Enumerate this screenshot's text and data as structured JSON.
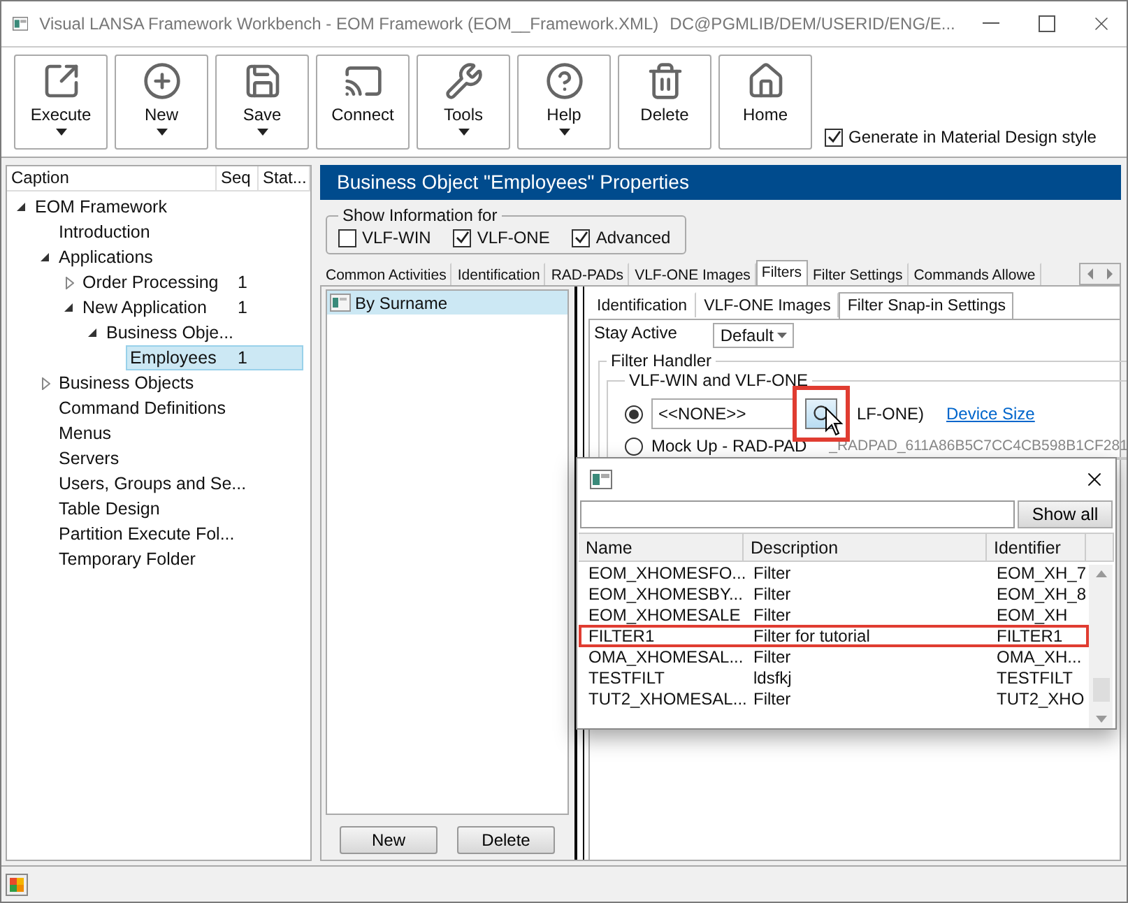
{
  "window": {
    "title": "Visual LANSA Framework Workbench - EOM Framework (EOM__Framework.XML)",
    "location": "DC@PGMLIB/DEM/USERID/ENG/E..."
  },
  "toolbar": [
    {
      "label": "Execute",
      "dropdown": true
    },
    {
      "label": "New",
      "dropdown": true
    },
    {
      "label": "Save",
      "dropdown": true
    },
    {
      "label": "Connect",
      "dropdown": false
    },
    {
      "label": "Tools",
      "dropdown": true
    },
    {
      "label": "Help",
      "dropdown": true
    },
    {
      "label": "Delete",
      "dropdown": false
    },
    {
      "label": "Home",
      "dropdown": false
    }
  ],
  "material_option": {
    "label": "Generate in Material Design style",
    "checked": true
  },
  "tree": {
    "columns": [
      "Caption",
      "Seq",
      "Stat..."
    ],
    "items": [
      {
        "label": "EOM Framework",
        "expanded": true,
        "selected": false,
        "children": [
          {
            "label": "Introduction",
            "selected": false
          },
          {
            "label": "Applications",
            "expanded": true,
            "selected": false,
            "children": [
              {
                "label": "Order Processing",
                "seq": "1",
                "expanded": false,
                "selected": false
              },
              {
                "label": "New Application",
                "seq": "1",
                "expanded": true,
                "selected": false,
                "children": [
                  {
                    "label": "Business Obje...",
                    "expanded": true,
                    "selected": false,
                    "children": [
                      {
                        "label": "Employees",
                        "seq": "1",
                        "selected": true
                      }
                    ]
                  }
                ]
              }
            ]
          },
          {
            "label": "Business Objects",
            "expanded": false,
            "selected": false
          },
          {
            "label": "Command Definitions",
            "selected": false
          },
          {
            "label": "Menus",
            "selected": false
          },
          {
            "label": "Servers",
            "selected": false
          },
          {
            "label": "Users, Groups and Se...",
            "selected": false
          },
          {
            "label": "Table Design",
            "selected": false
          },
          {
            "label": "Partition Execute Fol...",
            "selected": false
          },
          {
            "label": "Temporary Folder",
            "selected": false
          }
        ]
      }
    ]
  },
  "properties": {
    "title": "Business Object \"Employees\" Properties",
    "show_info": {
      "legend": "Show Information for",
      "options": [
        {
          "label": "VLF-WIN",
          "checked": false
        },
        {
          "label": "VLF-ONE",
          "checked": true
        },
        {
          "label": "Advanced",
          "checked": true
        }
      ]
    },
    "tabs": [
      {
        "label": "Common Activities",
        "selected": false
      },
      {
        "label": "Identification",
        "selected": false
      },
      {
        "label": "RAD-PADs",
        "selected": false
      },
      {
        "label": "VLF-ONE Images",
        "selected": false
      },
      {
        "label": "Filters",
        "selected": true
      },
      {
        "label": "Filter Settings",
        "selected": false
      },
      {
        "label": "Commands Allowe",
        "selected": false
      }
    ],
    "filters": [
      {
        "label": "By Surname",
        "selected": true
      }
    ],
    "filter_buttons": [
      "New",
      "Delete"
    ],
    "subtabs": [
      {
        "label": "Identification",
        "selected": false
      },
      {
        "label": "VLF-ONE Images",
        "selected": false
      },
      {
        "label": "Filter Snap-in Settings",
        "selected": true
      }
    ],
    "stay_active": {
      "label": "Stay Active",
      "value": "Default"
    },
    "filter_handler": {
      "legend": "Filter Handler",
      "group_legend": "VLF-WIN and VLF-ONE",
      "options": [
        {
          "kind": "field",
          "selected": true,
          "value": "<<NONE>>",
          "search_highlighted": true,
          "note": "LF-ONE)",
          "link": "Device Size"
        },
        {
          "kind": "text",
          "selected": false,
          "label": "Mock Up - RAD-PAD",
          "value": "_RADPAD_611A86B5C7CC4CB598B1CF281"
        }
      ]
    }
  },
  "picker": {
    "show_all": "Show all",
    "columns": [
      "Name",
      "Description",
      "Identifier"
    ],
    "rows": [
      {
        "cells": [
          "EOM_XHOMESFO...",
          "Filter",
          "EOM_XH_7"
        ],
        "highlighted": false
      },
      {
        "cells": [
          "EOM_XHOMESBY...",
          "Filter",
          "EOM_XH_8"
        ],
        "highlighted": false
      },
      {
        "cells": [
          "EOM_XHOMESALE",
          "Filter",
          "EOM_XH"
        ],
        "highlighted": false
      },
      {
        "cells": [
          "FILTER1",
          "Filter for tutorial",
          "FILTER1"
        ],
        "highlighted": true
      },
      {
        "cells": [
          "OMA_XHOMESAL...",
          "Filter",
          "OMA_XH..."
        ],
        "highlighted": false
      },
      {
        "cells": [
          "TESTFILT",
          "ldsfkj",
          "TESTFILT"
        ],
        "highlighted": false
      },
      {
        "cells": [
          "TUT2_XHOMESAL...",
          "Filter",
          "TUT2_XHO"
        ],
        "highlighted": false
      }
    ]
  }
}
